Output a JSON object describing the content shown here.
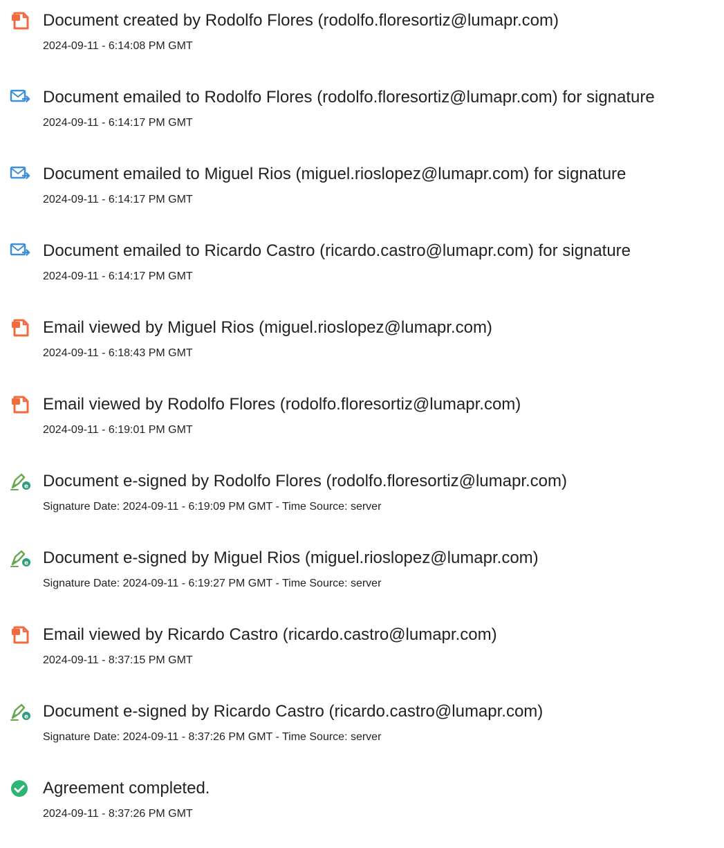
{
  "events": [
    {
      "icon": "document-icon",
      "title": "Document created by Rodolfo Flores (rodolfo.floresortiz@lumapr.com)",
      "detail": "2024-09-11 - 6:14:08 PM GMT"
    },
    {
      "icon": "email-sent-icon",
      "title": "Document emailed to Rodolfo Flores (rodolfo.floresortiz@lumapr.com) for signature",
      "detail": "2024-09-11 - 6:14:17 PM GMT"
    },
    {
      "icon": "email-sent-icon",
      "title": "Document emailed to Miguel Rios (miguel.rioslopez@lumapr.com) for signature",
      "detail": "2024-09-11 - 6:14:17 PM GMT"
    },
    {
      "icon": "email-sent-icon",
      "title": "Document emailed to Ricardo Castro (ricardo.castro@lumapr.com) for signature",
      "detail": "2024-09-11 - 6:14:17 PM GMT"
    },
    {
      "icon": "document-icon",
      "title": "Email viewed by Miguel Rios (miguel.rioslopez@lumapr.com)",
      "detail": "2024-09-11 - 6:18:43 PM GMT"
    },
    {
      "icon": "document-icon",
      "title": "Email viewed by Rodolfo Flores (rodolfo.floresortiz@lumapr.com)",
      "detail": "2024-09-11 - 6:19:01 PM GMT"
    },
    {
      "icon": "e-sign-pen-icon",
      "title": "Document e-signed by Rodolfo Flores (rodolfo.floresortiz@lumapr.com)",
      "detail": "Signature Date: 2024-09-11 - 6:19:09 PM GMT - Time Source: server"
    },
    {
      "icon": "e-sign-pen-icon",
      "title": "Document e-signed by Miguel Rios (miguel.rioslopez@lumapr.com)",
      "detail": "Signature Date: 2024-09-11 - 6:19:27 PM GMT - Time Source: server"
    },
    {
      "icon": "document-icon",
      "title": "Email viewed by Ricardo Castro (ricardo.castro@lumapr.com)",
      "detail": "2024-09-11 - 8:37:15 PM GMT"
    },
    {
      "icon": "e-sign-pen-icon",
      "title": "Document e-signed by Ricardo Castro (ricardo.castro@lumapr.com)",
      "detail": "Signature Date: 2024-09-11 - 8:37:26 PM GMT - Time Source: server"
    },
    {
      "icon": "checkmark-circle-icon",
      "title": "Agreement completed.",
      "detail": "2024-09-11 - 8:37:26 PM GMT"
    }
  ],
  "colors": {
    "document_icon": "#f26a3d",
    "email_icon": "#3d8fd8",
    "sign_icon": "#6aa84f",
    "check_icon": "#2bb673",
    "text": "#222222"
  }
}
